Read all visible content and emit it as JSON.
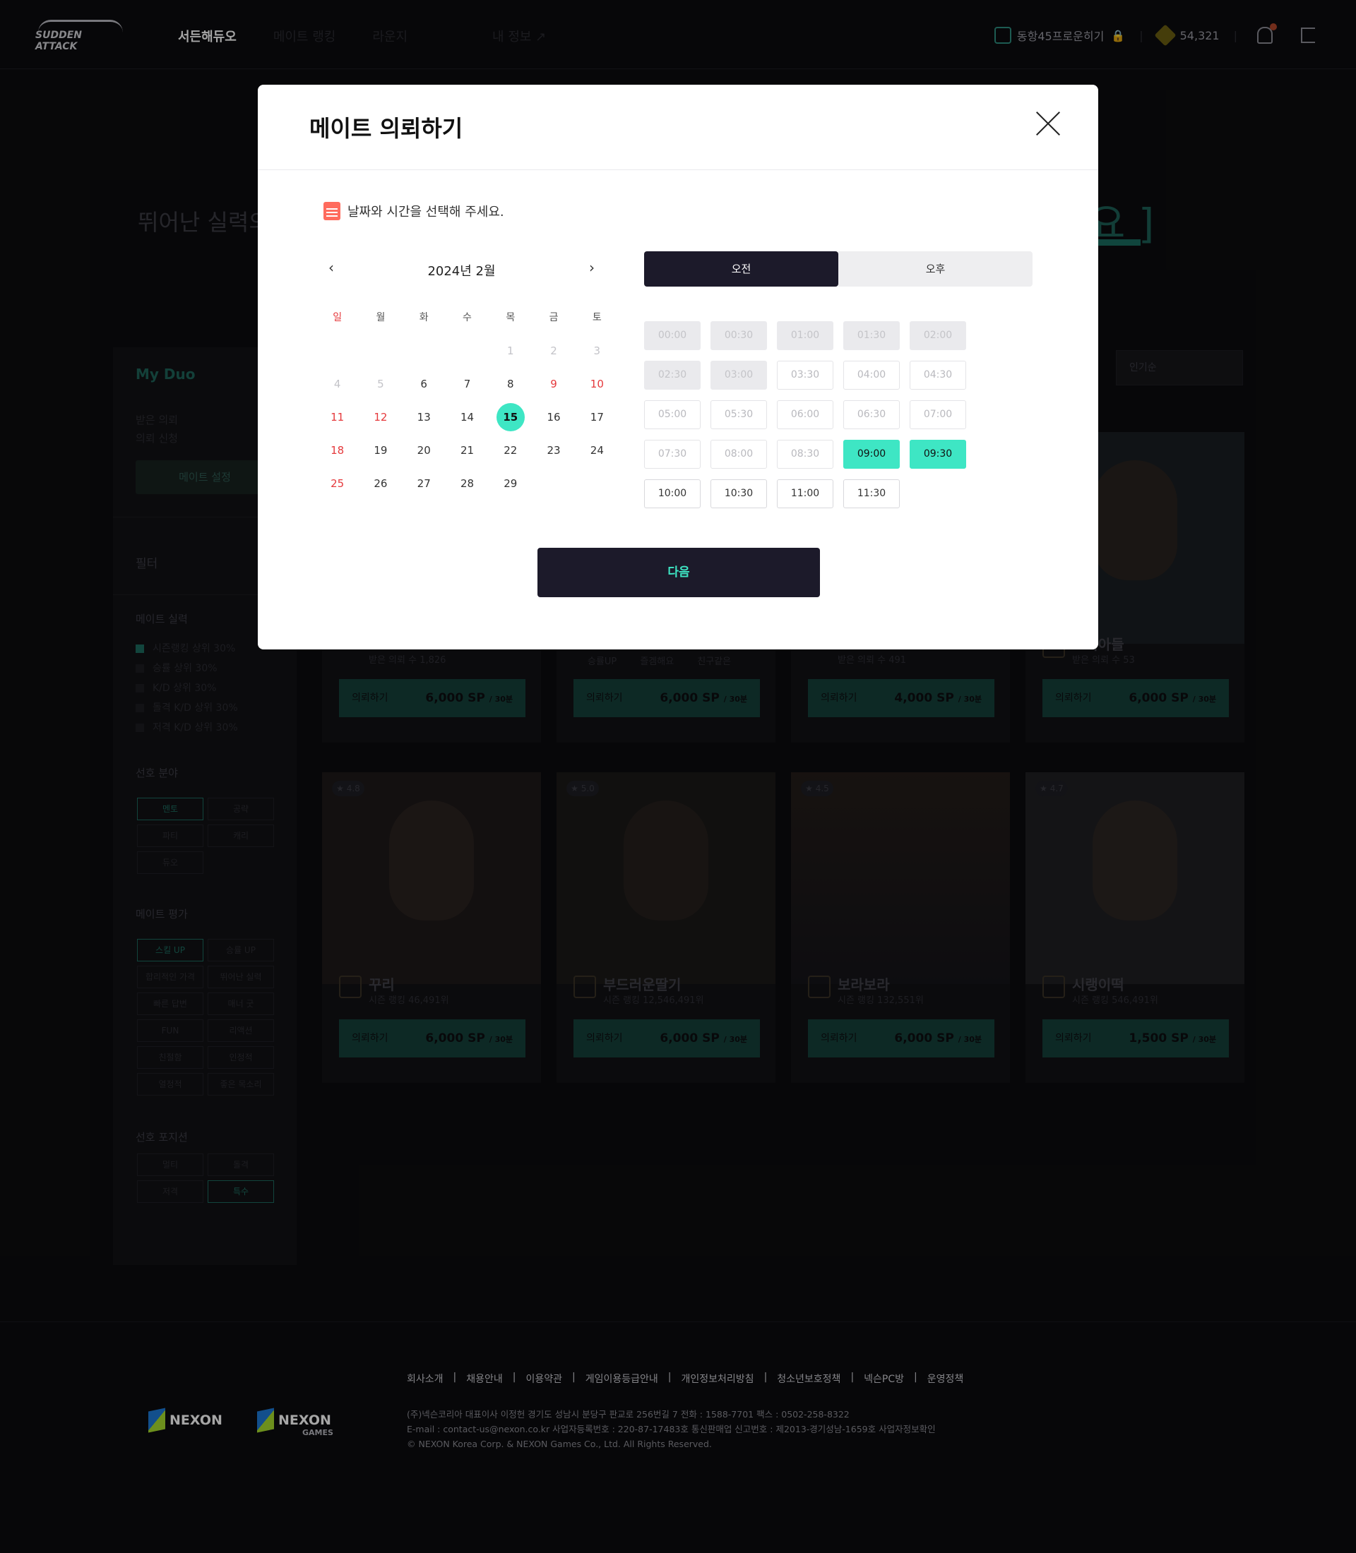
{
  "header": {
    "logo_text": "SUDDEN ATTACK",
    "nav": [
      "서든해듀오",
      "메이트 랭킹",
      "라운지",
      "내 정보 ↗"
    ],
    "user_label": "동항45프로운히기",
    "points": "54,321"
  },
  "hero": {
    "text": "뛰어난 실력의",
    "right": "요 ]"
  },
  "sidebar": {
    "title": "My Duo",
    "received": "받은 의뢰",
    "requested": "의뢰 신청",
    "settings_button": "메이트 설정",
    "filter_title": "필터",
    "skill_title": "메이트 실력",
    "skill_options": [
      "시즌랭킹 상위 30%",
      "승률 상위 30%",
      "K/D 상위 30%",
      "돌격 K/D 상위 30%",
      "저격 K/D 상위 30%"
    ],
    "pref_title": "선호 분야",
    "pref_tags": [
      "멘토",
      "공략",
      "파티",
      "캐리",
      "듀오"
    ],
    "eval_title": "메이트 평가",
    "eval_tags": [
      "스킬 UP",
      "승률 UP",
      "합리적인 가격",
      "뛰어난 실력",
      "빠른 답변",
      "매너 굿",
      "FUN",
      "리액션",
      "친절함",
      "인정적",
      "열정적",
      "좋은 목소리"
    ],
    "pos_title": "선호 포지션",
    "pos_tags": [
      "멀티",
      "돌격",
      "저격",
      "특수"
    ]
  },
  "sort_label": "인기순",
  "cards_top": [
    {
      "stat": "받은 의뢰 수",
      "count": "1,826",
      "request": "의뢰하기",
      "price": "6,000 SP",
      "unit": "/ 30분"
    },
    {
      "tags": [
        "승률UP",
        "즐겜해요",
        "친구같은"
      ],
      "request": "의뢰하기",
      "price": "6,000 SP",
      "unit": "/ 30분"
    },
    {
      "stat": "받은 의뢰 수",
      "count": "491",
      "request": "의뢰하기",
      "price": "4,000 SP",
      "unit": "/ 30분"
    },
    {
      "name": "도의아들",
      "stat": "받은 의뢰 수",
      "count": "53",
      "request": "의뢰하기",
      "price": "6,000 SP",
      "unit": "/ 30분"
    }
  ],
  "cards_bottom": [
    {
      "rating": "4.8",
      "name": "꾸리",
      "rank": "시즌 랭킹  46,491위",
      "request": "의뢰하기",
      "price": "6,000 SP",
      "unit": "/ 30분"
    },
    {
      "rating": "5.0",
      "name": "부드러운딸기",
      "rank": "시즌 랭킹  12,546,491위",
      "request": "의뢰하기",
      "price": "6,000 SP",
      "unit": "/ 30분"
    },
    {
      "rating": "4.5",
      "name": "보라보라",
      "rank": "시즌 랭킹  132,551위",
      "request": "의뢰하기",
      "price": "6,000 SP",
      "unit": "/ 30분"
    },
    {
      "rating": "4.7",
      "name": "시랭이떡",
      "rank": "시즌 랭킹  546,491위",
      "request": "의뢰하기",
      "price": "1,500 SP",
      "unit": "/ 30분"
    }
  ],
  "footer": {
    "links": [
      "회사소개",
      "채용안내",
      "이용약관",
      "게임이용등급안내",
      "개인정보처리방침",
      "청소년보호정책",
      "넥슨PC방",
      "운영정책"
    ],
    "info1": "(주)넥슨코리아 대표이사 이정헌 경기도 성남시 분당구 판교로 256번길 7 전화 : 1588-7701 팩스 : 0502-258-8322",
    "info2": "E-mail : contact-us@nexon.co.kr 사업자등록번호 : 220-87-17483호 통신판매업 신고번호 : 제2013-경기성남-1659호 사업자정보확인",
    "info3": "© NEXON Korea Corp. & NEXON Games Co., Ltd. All Rights Reserved.",
    "brand1": "NEXON",
    "brand2": "NEXON",
    "brand2_sub": "GAMES"
  },
  "modal": {
    "title": "메이트 의뢰하기",
    "guide": "날짜와 시간을 선택해 주세요.",
    "month": "2024년 2월",
    "weekdays": [
      "일",
      "월",
      "화",
      "수",
      "목",
      "금",
      "토"
    ],
    "weeks": [
      [
        "",
        "",
        "",
        "",
        "1",
        "2",
        "3"
      ],
      [
        "4",
        "5",
        "6",
        "7",
        "8",
        "9",
        "10"
      ],
      [
        "11",
        "12",
        "13",
        "14",
        "15",
        "16",
        "17"
      ],
      [
        "18",
        "19",
        "20",
        "21",
        "22",
        "23",
        "24"
      ],
      [
        "25",
        "26",
        "27",
        "28",
        "29",
        "",
        ""
      ]
    ],
    "selected_day": "15",
    "am_label": "오전",
    "pm_label": "오후",
    "times": [
      "00:00",
      "00:30",
      "01:00",
      "01:30",
      "02:00",
      "02:30",
      "03:00",
      "03:30",
      "04:00",
      "04:30",
      "05:00",
      "05:30",
      "06:00",
      "06:30",
      "07:00",
      "07:30",
      "08:00",
      "08:30",
      "09:00",
      "09:30",
      "10:00",
      "10:30",
      "11:00",
      "11:30"
    ],
    "disabled_count": 7,
    "selected_times": [
      "09:00",
      "09:30"
    ],
    "next_label": "다음"
  }
}
